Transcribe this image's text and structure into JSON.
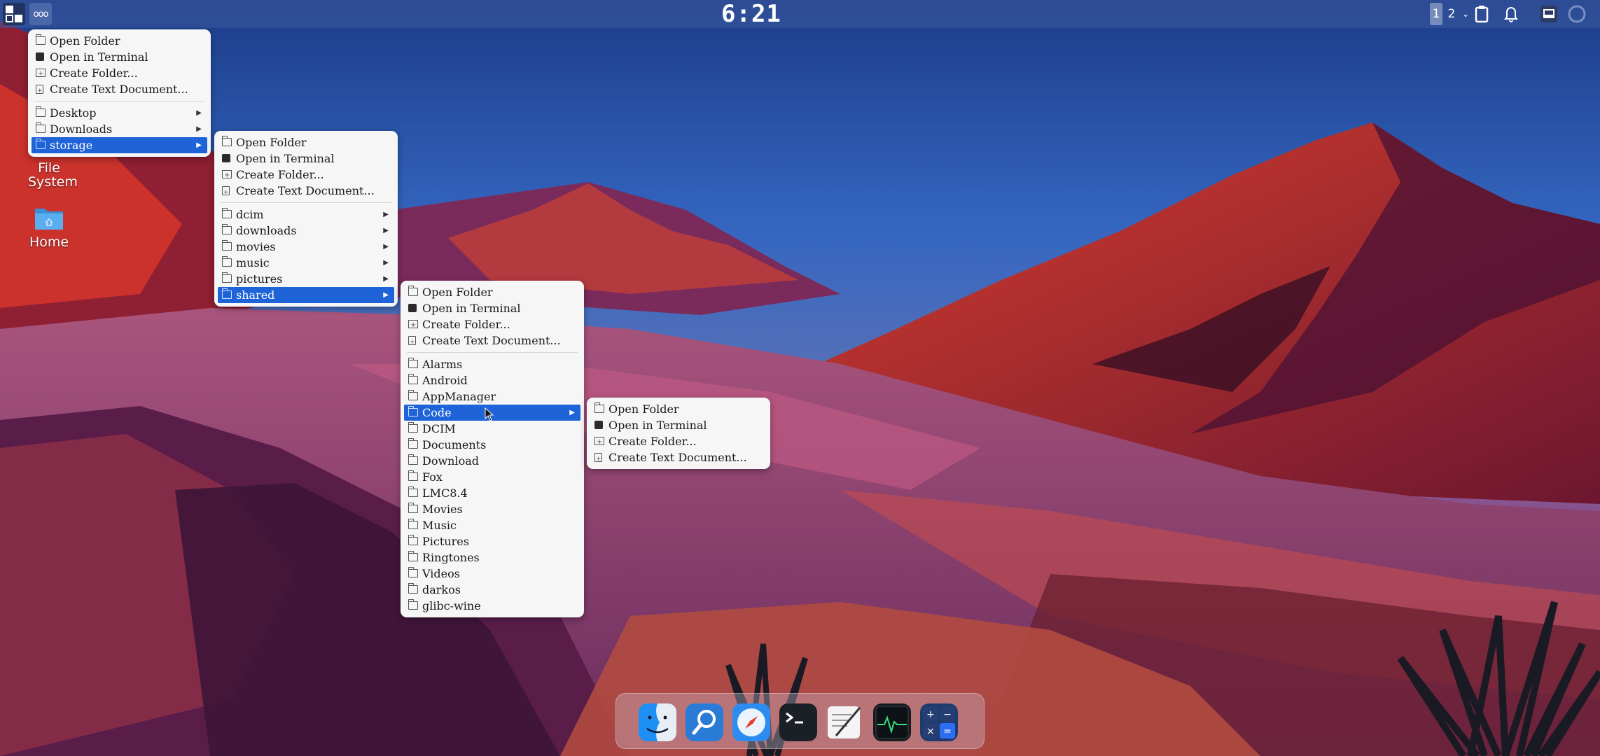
{
  "top_panel": {
    "clock": "6:21",
    "workspaces": [
      "1",
      "2"
    ]
  },
  "desktop_icons": [
    {
      "label": "File System"
    },
    {
      "label": "Home"
    }
  ],
  "menus": {
    "root": {
      "actions": [
        "Open Folder",
        "Open in Terminal",
        "Create Folder...",
        "Create Text Document..."
      ],
      "folders": [
        "Desktop",
        "Downloads",
        "storage"
      ],
      "selected": "storage"
    },
    "storage": {
      "actions": [
        "Open Folder",
        "Open in Terminal",
        "Create Folder...",
        "Create Text Document..."
      ],
      "folders": [
        "dcim",
        "downloads",
        "movies",
        "music",
        "pictures",
        "shared"
      ],
      "selected": "shared"
    },
    "shared": {
      "actions": [
        "Open Folder",
        "Open in Terminal",
        "Create Folder...",
        "Create Text Document..."
      ],
      "folders": [
        "Alarms",
        "Android",
        "AppManager",
        "Code",
        "DCIM",
        "Documents",
        "Download",
        "Fox",
        "LMC8.4",
        "Movies",
        "Music",
        "Pictures",
        "Ringtones",
        "Videos",
        "darkos",
        "glibc-wine"
      ],
      "selected": "Code"
    },
    "code": {
      "actions": [
        "Open Folder",
        "Open in Terminal",
        "Create Folder...",
        "Create Text Document..."
      ]
    }
  },
  "dock": {
    "apps": [
      "finder-icon",
      "search-icon",
      "safari-compass-icon",
      "terminal-icon",
      "text-editor-icon",
      "activity-monitor-icon",
      "calculator-icon"
    ]
  },
  "colors": {
    "selection": "#1f63d8",
    "menu_bg": "#f6f6f6"
  }
}
